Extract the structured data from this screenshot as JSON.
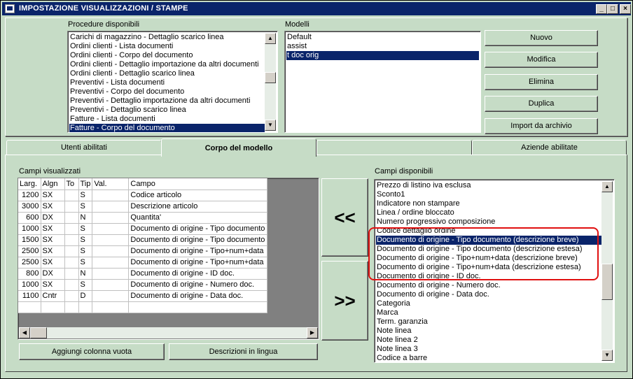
{
  "window": {
    "title": "IMPOSTAZIONE VISUALIZZAZIONI / STAMPE",
    "minimize": "_",
    "maximize": "□",
    "close": "×"
  },
  "procedure": {
    "label": "Procedure disponibili",
    "items": [
      "Carichi di magazzino - Dettaglio scarico linea",
      "Ordini clienti - Lista documenti",
      "Ordini clienti - Corpo del documento",
      "Ordini clienti - Dettaglio importazione da altri documenti",
      "Ordini clienti - Dettaglio scarico linea",
      "Preventivi - Lista documenti",
      "Preventivi - Corpo del documento",
      "Preventivi - Dettaglio importazione da altri documenti",
      "Preventivi - Dettaglio scarico linea",
      "Fatture - Lista documenti",
      "Fatture - Corpo del documento"
    ],
    "selected": "Fatture - Corpo del documento"
  },
  "modelli": {
    "label": "Modelli",
    "items": [
      "Default",
      "assist",
      "t doc orig"
    ],
    "selected": "t doc orig"
  },
  "buttons": {
    "nuovo": "Nuovo",
    "modifica": "Modifica",
    "elimina": "Elimina",
    "duplica": "Duplica",
    "import": "Import da archivio"
  },
  "tabs": [
    "Utenti abilitati",
    "Corpo del modello",
    "",
    "Aziende abilitate"
  ],
  "active_tab": "Corpo del modello",
  "campi_visualizzati": {
    "label": "Campi visualizzati",
    "columns": [
      "Larg.",
      "Algn",
      "To",
      "Tip",
      "Val.",
      "Campo"
    ],
    "rows": [
      [
        "1200",
        "SX",
        "",
        "S",
        "",
        "Codice articolo"
      ],
      [
        "3000",
        "SX",
        "",
        "S",
        "",
        "Descrizione articolo"
      ],
      [
        "600",
        "DX",
        "",
        "N",
        "",
        "Quantita'"
      ],
      [
        "1000",
        "SX",
        "",
        "S",
        "",
        "Documento di origine - Tipo documento"
      ],
      [
        "1500",
        "SX",
        "",
        "S",
        "",
        "Documento di origine - Tipo documento"
      ],
      [
        "2500",
        "SX",
        "",
        "S",
        "",
        "Documento di origine - Tipo+num+data"
      ],
      [
        "2500",
        "SX",
        "",
        "S",
        "",
        "Documento di origine - Tipo+num+data"
      ],
      [
        "800",
        "DX",
        "",
        "N",
        "",
        "Documento di origine - ID doc."
      ],
      [
        "1000",
        "SX",
        "",
        "S",
        "",
        "Documento di origine - Numero doc."
      ],
      [
        "1100",
        "Cntr",
        "",
        "D",
        "",
        "Documento di origine - Data doc."
      ]
    ]
  },
  "move_buttons": {
    "left": "<<",
    "right": ">>"
  },
  "bottom_buttons": {
    "aggiungi": "Aggiungi colonna vuota",
    "descrizioni": "Descrizioni in lingua"
  },
  "campi_disponibili": {
    "label": "Campi disponibili",
    "items": [
      "Prezzo di listino iva esclusa",
      "Sconto1",
      "Indicatore non stampare",
      "Linea / ordine bloccato",
      "Numero progressivo composizione",
      "Codice dettaglio ordine",
      "Documento di origine - Tipo documento (descrizione breve)",
      "Documento di origine - Tipo documento (descrizione estesa)",
      "Documento di origine - Tipo+num+data (descrizione breve)",
      "Documento di origine - Tipo+num+data (descrizione estesa)",
      "Documento di origine - ID doc.",
      "Documento di origine - Numero doc.",
      "Documento di origine - Data doc.",
      "Categoria",
      "Marca",
      "Term. garanzia",
      "Note linea",
      "Note linea 2",
      "Note linea 3",
      "Codice a barre"
    ],
    "selected": "Documento di origine - Tipo documento (descrizione breve)"
  },
  "colors": {
    "background": "#c6dcc6",
    "selection": "#0a246a",
    "highlight_box": "#e01010"
  }
}
